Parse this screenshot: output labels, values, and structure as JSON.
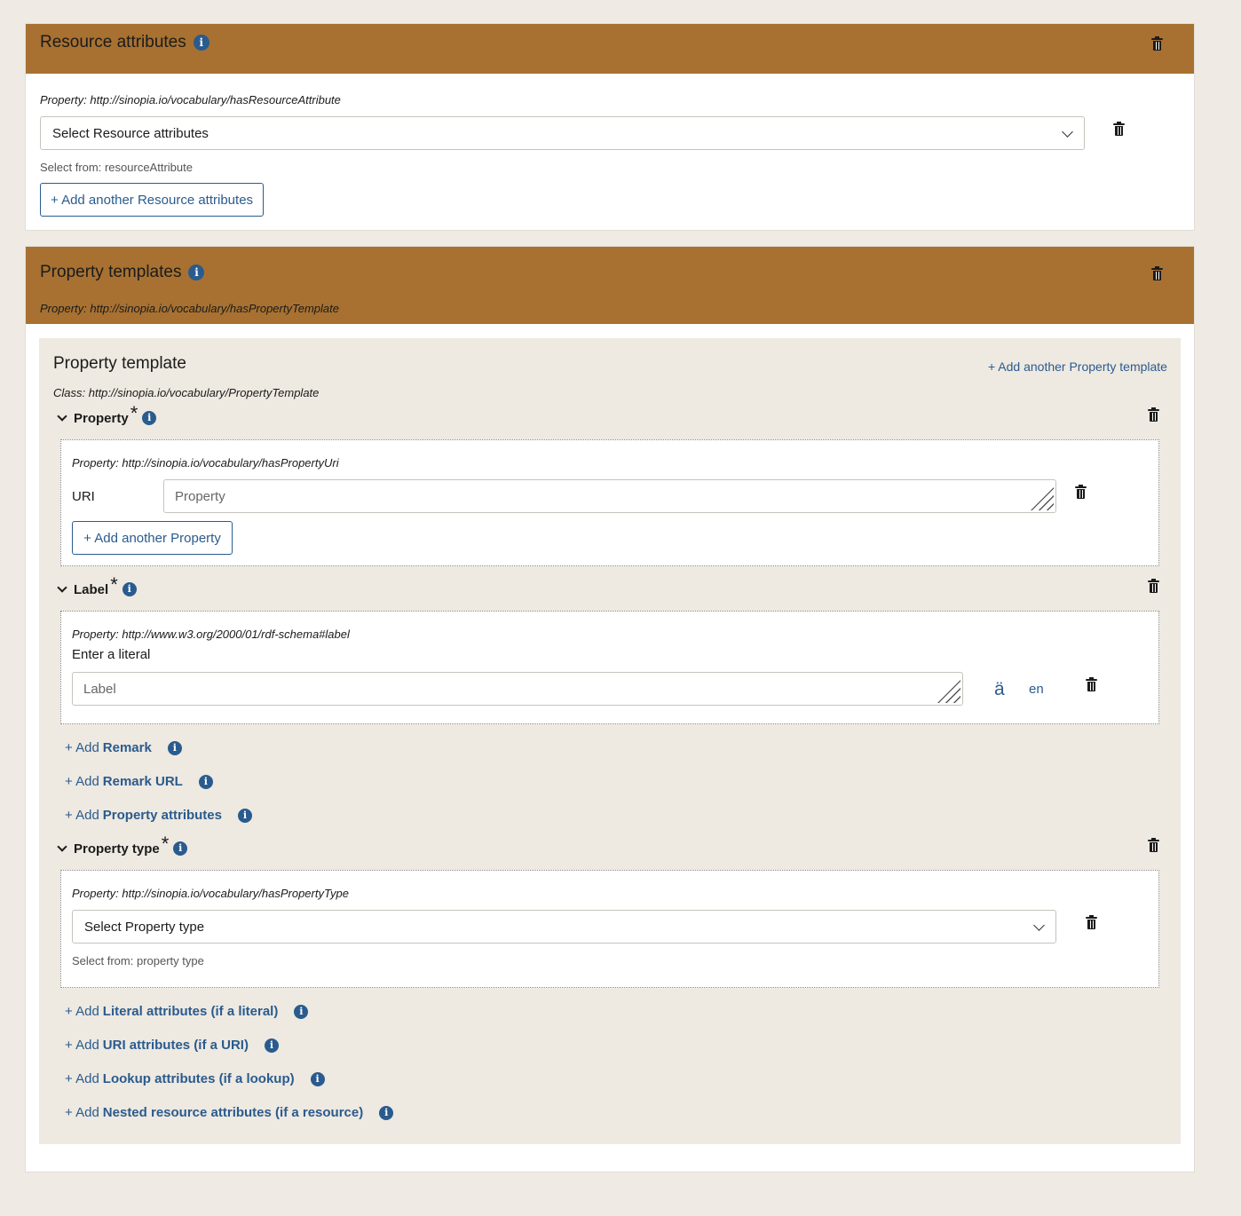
{
  "resource_attributes": {
    "title": "Resource attributes",
    "property": "Property: http://sinopia.io/vocabulary/hasResourceAttribute",
    "select_value": "Select Resource attributes",
    "select_from": "Select from: resourceAttribute",
    "add_button": "+ Add another Resource attributes"
  },
  "property_templates": {
    "title": "Property templates",
    "property": "Property: http://sinopia.io/vocabulary/hasPropertyTemplate",
    "template": {
      "title": "Property template",
      "add_another": "+ Add another Property template",
      "class_line": "Class: http://sinopia.io/vocabulary/PropertyTemplate",
      "property_section": {
        "label": "Property",
        "required": "*",
        "property": "Property: http://sinopia.io/vocabulary/hasPropertyUri",
        "uri_label": "URI",
        "placeholder": "Property",
        "add_button": "+ Add another Property"
      },
      "label_section": {
        "label": "Label",
        "required": "*",
        "property": "Property: http://www.w3.org/2000/01/rdf-schema#label",
        "enter_literal": "Enter a literal",
        "placeholder": "Label",
        "diacritic": "ä",
        "lang": "en"
      },
      "optional_links_1": [
        {
          "prefix": "+ Add",
          "name": "Remark"
        },
        {
          "prefix": "+ Add",
          "name": "Remark URL"
        },
        {
          "prefix": "+ Add",
          "name": "Property attributes"
        }
      ],
      "type_section": {
        "label": "Property type",
        "required": "*",
        "property": "Property: http://sinopia.io/vocabulary/hasPropertyType",
        "select_value": "Select Property type",
        "select_from": "Select from: property type"
      },
      "optional_links_2": [
        {
          "prefix": "+ Add",
          "name": "Literal attributes (if a literal)"
        },
        {
          "prefix": "+ Add",
          "name": "URI attributes (if a URI)"
        },
        {
          "prefix": "+ Add",
          "name": "Lookup attributes (if a lookup)"
        },
        {
          "prefix": "+ Add",
          "name": "Nested resource attributes (if a resource)"
        }
      ]
    }
  },
  "colors": {
    "header": "#a87131",
    "link": "#2a5b8e",
    "background": "#efebe4"
  },
  "icons": [
    "info-icon",
    "trash-icon",
    "chevron-down-icon",
    "caret-down-icon",
    "resize-handle-icon"
  ]
}
